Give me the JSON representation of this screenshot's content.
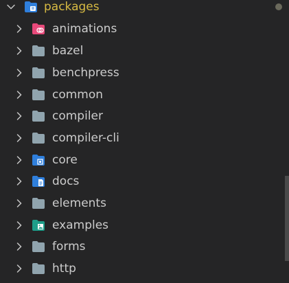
{
  "explorer": {
    "root": {
      "label": "packages",
      "expanded": true,
      "icon": "folder-open-special-icon",
      "color": "#d7ba43",
      "status": "modified-dot"
    },
    "items": [
      {
        "label": "animations",
        "icon": "folder-animations-icon",
        "color": "#e8497a"
      },
      {
        "label": "bazel",
        "icon": "folder-icon",
        "color": "#90a4ae"
      },
      {
        "label": "benchpress",
        "icon": "folder-icon",
        "color": "#90a4ae"
      },
      {
        "label": "common",
        "icon": "folder-icon",
        "color": "#90a4ae"
      },
      {
        "label": "compiler",
        "icon": "folder-icon",
        "color": "#90a4ae"
      },
      {
        "label": "compiler-cli",
        "icon": "folder-icon",
        "color": "#90a4ae"
      },
      {
        "label": "core",
        "icon": "folder-core-icon",
        "color": "#2f7fdc"
      },
      {
        "label": "docs",
        "icon": "folder-docs-icon",
        "color": "#2f7fdc"
      },
      {
        "label": "elements",
        "icon": "folder-icon",
        "color": "#90a4ae"
      },
      {
        "label": "examples",
        "icon": "folder-examples-icon",
        "color": "#1e9e8a"
      },
      {
        "label": "forms",
        "icon": "folder-icon",
        "color": "#90a4ae"
      },
      {
        "label": "http",
        "icon": "folder-icon",
        "color": "#90a4ae"
      }
    ]
  }
}
